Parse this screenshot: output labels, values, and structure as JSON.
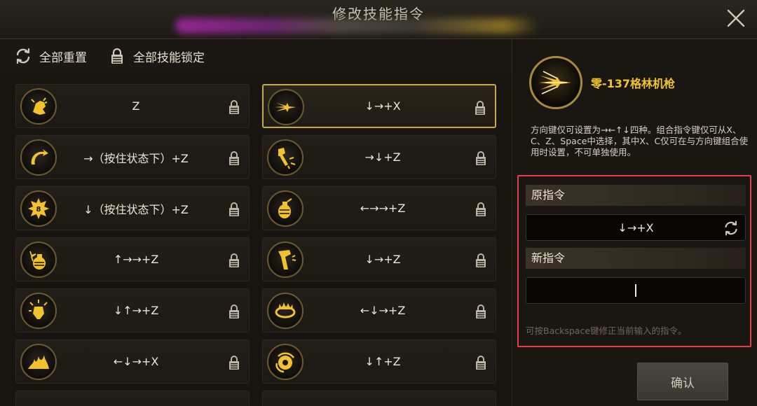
{
  "window": {
    "title": "修改技能指令"
  },
  "toolbar": {
    "reset_all_label": "全部重置",
    "lock_all_label": "全部技能锁定"
  },
  "skills": [
    {
      "icon": "fist-punch-icon",
      "command": "Z",
      "selected": false
    },
    {
      "icon": "energy-burst-icon",
      "command": "↓→+X",
      "selected": true
    },
    {
      "icon": "spin-kick-icon",
      "command": "→（按住状态下）+Z",
      "selected": false
    },
    {
      "icon": "hammer-strike-icon",
      "command": "→↓+Z",
      "selected": false
    },
    {
      "icon": "boom-badge-icon",
      "command": "↓（按住状态下）+Z",
      "selected": false
    },
    {
      "icon": "grenade-icon",
      "command": "←→→+Z",
      "selected": false
    },
    {
      "icon": "grenade-sparkle-icon",
      "command": "↑→→+Z",
      "selected": false
    },
    {
      "icon": "leg-kick-icon",
      "command": "↓→+Z",
      "selected": false
    },
    {
      "icon": "flash-bulb-icon",
      "command": "↓↑→+Z",
      "selected": false
    },
    {
      "icon": "fire-ring-icon",
      "command": "←↓→+Z",
      "selected": false
    },
    {
      "icon": "flame-wave-icon",
      "command": "←↓→+X",
      "selected": false
    },
    {
      "icon": "fire-orb-icon",
      "command": "↓↑+Z",
      "selected": false
    }
  ],
  "detail": {
    "skill_name": "零-137格林机枪",
    "skill_icon": "gatling-gun-icon",
    "description": "方向键仅可设置为→←↑↓四种。组合指令键仅可从X、C、Z、Space中选择，其中X、C仅可在与方向键组合使用时设置，不可单独使用。",
    "original_label": "原指令",
    "original_value": "↓→+X",
    "new_label": "新指令",
    "new_value": "",
    "hint": "可按Backspace键修正当前输入的指令。",
    "confirm_label": "确认"
  },
  "colors": {
    "accent_gold": "#f1c22e",
    "highlight_red": "#e2434b",
    "selected_border": "#c9a84a"
  }
}
